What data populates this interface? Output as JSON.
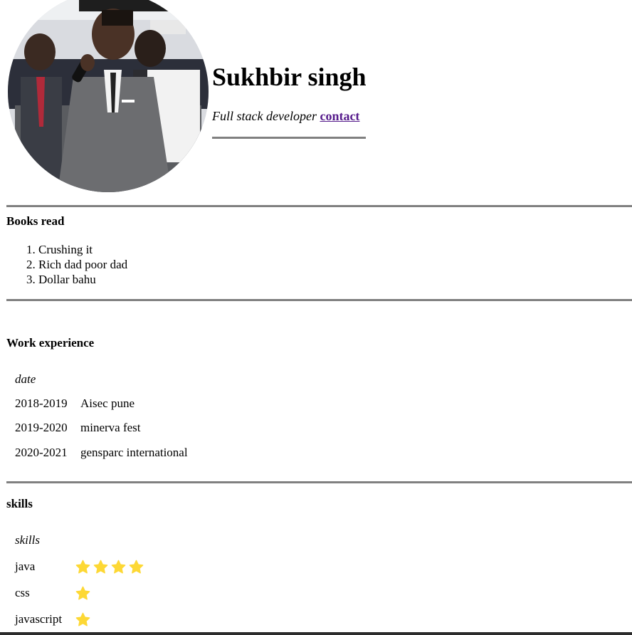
{
  "header": {
    "name": "Sukhbir singh",
    "role": "Full stack developer",
    "contact_label": "contact"
  },
  "books": {
    "title": "Books read",
    "items": [
      "Crushing it",
      "Rich dad poor dad",
      "Dollar bahu"
    ]
  },
  "work": {
    "title": "Work experience",
    "caption": "date",
    "rows": [
      {
        "years": "2018-2019",
        "org": "Aisec pune"
      },
      {
        "years": "2019-2020",
        "org": "minerva fest"
      },
      {
        "years": "2020-2021",
        "org": "gensparc international"
      }
    ]
  },
  "skills": {
    "title": "skills",
    "caption": "skills",
    "items": [
      {
        "name": "java",
        "stars": 4
      },
      {
        "name": "css",
        "stars": 1
      },
      {
        "name": "javascript",
        "stars": 1
      }
    ]
  },
  "colors": {
    "star": "#fdd835",
    "divider": "#808080",
    "link_visited": "#551a8b"
  },
  "icons": {
    "star": "star-icon"
  }
}
